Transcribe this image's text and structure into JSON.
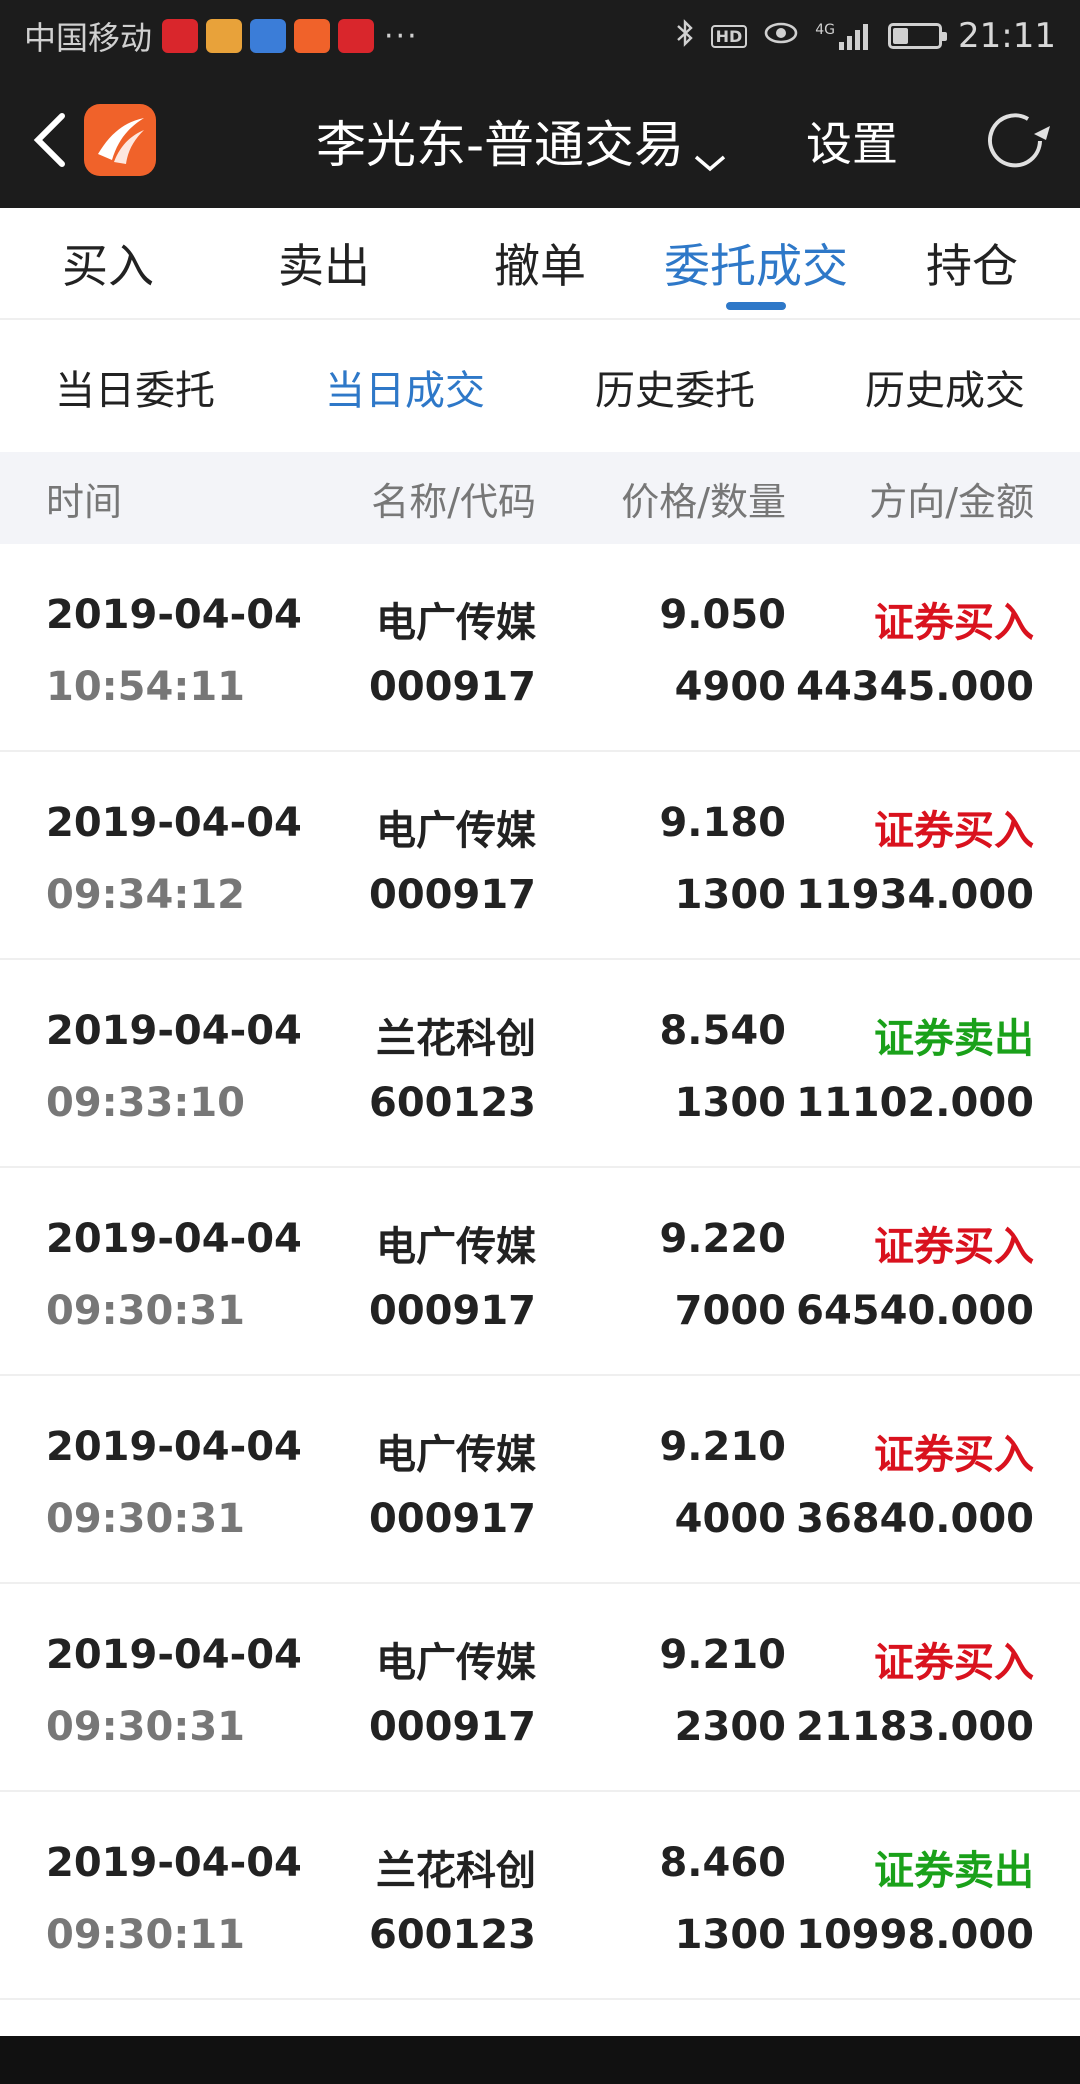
{
  "status_bar": {
    "carrier": "中国移动",
    "more": "···",
    "time": "21:11",
    "hd": "HD",
    "network": "4G",
    "battery_level": 0.35,
    "apps": [
      {
        "name": "app-red-icon",
        "color": "#d9262c"
      },
      {
        "name": "app-play-icon",
        "color": "#e8a23a"
      },
      {
        "name": "app-blue-icon",
        "color": "#3b7dd8"
      },
      {
        "name": "app-orange-icon",
        "color": "#f0622a"
      },
      {
        "name": "app-bank-icon",
        "color": "#d9262c"
      }
    ]
  },
  "nav": {
    "title": "李光东-普通交易",
    "settings": "设置"
  },
  "main_tabs": [
    {
      "label": "买入",
      "active": false
    },
    {
      "label": "卖出",
      "active": false
    },
    {
      "label": "撤单",
      "active": false
    },
    {
      "label": "委托成交",
      "active": true
    },
    {
      "label": "持仓",
      "active": false
    }
  ],
  "sub_tabs": [
    {
      "label": "当日委托",
      "active": false
    },
    {
      "label": "当日成交",
      "active": true
    },
    {
      "label": "历史委托",
      "active": false
    },
    {
      "label": "历史成交",
      "active": false
    }
  ],
  "table": {
    "headers": {
      "time": "时间",
      "name": "名称/代码",
      "price": "价格/数量",
      "direction": "方向/金额"
    },
    "colors": {
      "buy": "#d9121e",
      "sell": "#1aa11a"
    },
    "rows": [
      {
        "date": "2019-04-04",
        "time": "10:54:11",
        "name": "电广传媒",
        "code": "000917",
        "price": "9.050",
        "qty": "4900",
        "direction": "证券买入",
        "side": "buy",
        "amount": "44345.000"
      },
      {
        "date": "2019-04-04",
        "time": "09:34:12",
        "name": "电广传媒",
        "code": "000917",
        "price": "9.180",
        "qty": "1300",
        "direction": "证券买入",
        "side": "buy",
        "amount": "11934.000"
      },
      {
        "date": "2019-04-04",
        "time": "09:33:10",
        "name": "兰花科创",
        "code": "600123",
        "price": "8.540",
        "qty": "1300",
        "direction": "证券卖出",
        "side": "sell",
        "amount": "11102.000"
      },
      {
        "date": "2019-04-04",
        "time": "09:30:31",
        "name": "电广传媒",
        "code": "000917",
        "price": "9.220",
        "qty": "7000",
        "direction": "证券买入",
        "side": "buy",
        "amount": "64540.000"
      },
      {
        "date": "2019-04-04",
        "time": "09:30:31",
        "name": "电广传媒",
        "code": "000917",
        "price": "9.210",
        "qty": "4000",
        "direction": "证券买入",
        "side": "buy",
        "amount": "36840.000"
      },
      {
        "date": "2019-04-04",
        "time": "09:30:31",
        "name": "电广传媒",
        "code": "000917",
        "price": "9.210",
        "qty": "2300",
        "direction": "证券买入",
        "side": "buy",
        "amount": "21183.000"
      },
      {
        "date": "2019-04-04",
        "time": "09:30:11",
        "name": "兰花科创",
        "code": "600123",
        "price": "8.460",
        "qty": "1300",
        "direction": "证券卖出",
        "side": "sell",
        "amount": "10998.000"
      }
    ]
  }
}
